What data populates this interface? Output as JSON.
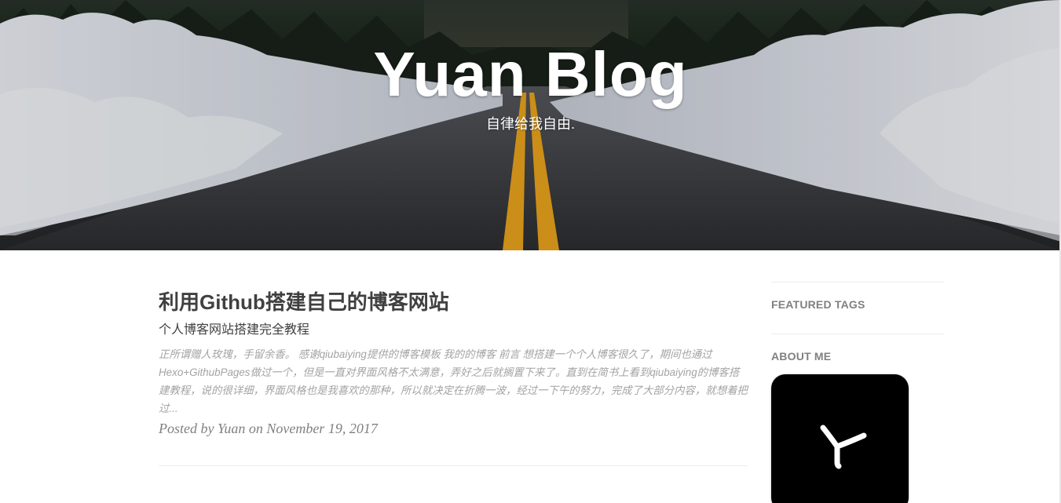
{
  "header": {
    "title": "Yuan Blog",
    "subtitle": "自律给我自由."
  },
  "posts": [
    {
      "title": "利用Github搭建自己的博客网站",
      "subtitle": "个人博客网站搭建完全教程",
      "excerpt": "正所谓赠人玫瑰，手留余香。 感谢qiubaiying提供的博客模板 我的的博客 前言 想搭建一个个人博客很久了，期间也通过Hexo+GithubPages做过一个，但是一直对界面风格不太满意，弄好之后就搁置下来了。直到在简书上看到qiubaiying的博客搭建教程，说的很详细，界面风格也是我喜欢的那种，所以就决定在折腾一波，经过一下午的努力，完成了大部分内容，就想着把过...",
      "meta": "Posted by Yuan on November 19, 2017"
    }
  ],
  "sidebar": {
    "featured_tags_heading": "FEATURED TAGS",
    "about_heading": "ABOUT ME",
    "avatar_icon": "y-logo-icon"
  },
  "colors": {
    "text": "#404040",
    "muted": "#808080",
    "excerpt": "#a3a3a3",
    "road_line": "#e8a21c",
    "avatar_bg": "#000000"
  }
}
